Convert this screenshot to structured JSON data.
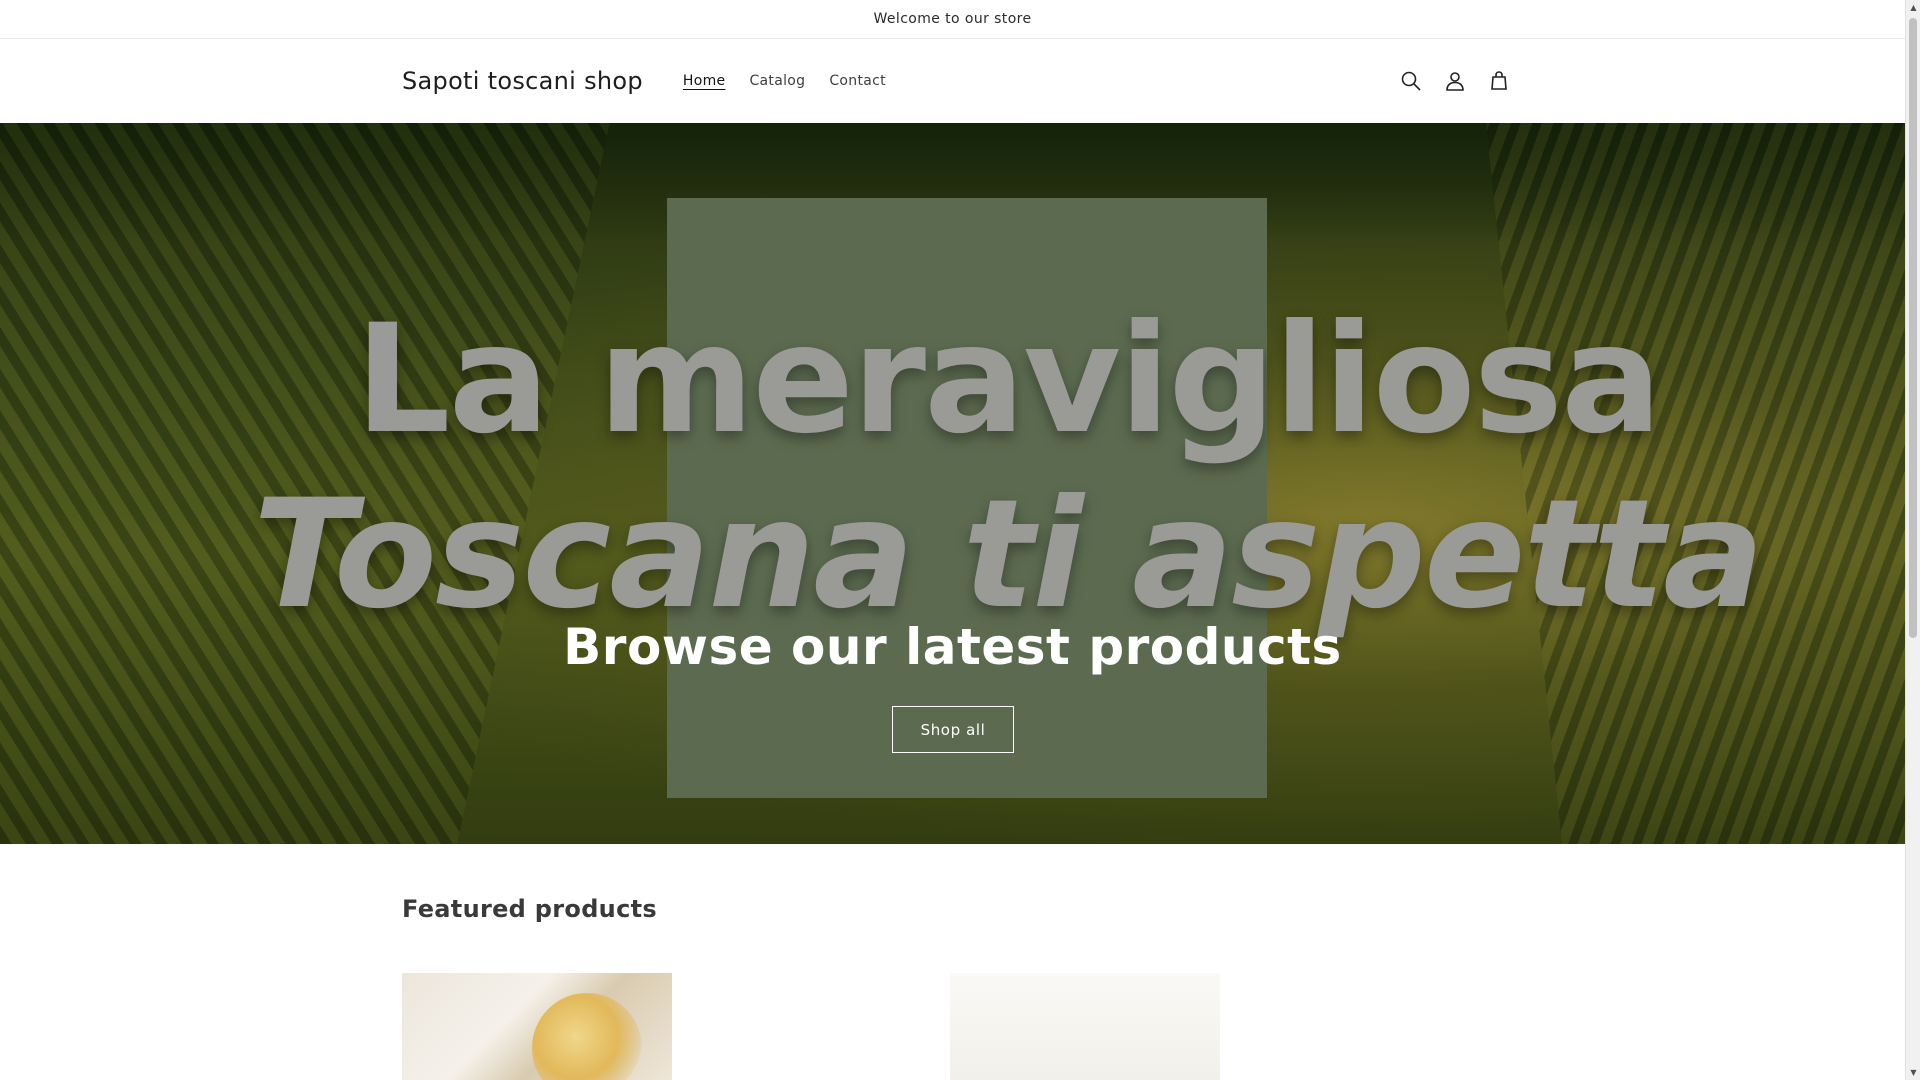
{
  "announcement": {
    "text": "Welcome to our store"
  },
  "header": {
    "logo": "Sapoti toscani shop",
    "nav": [
      {
        "label": "Home",
        "active": true
      },
      {
        "label": "Catalog",
        "active": false
      },
      {
        "label": "Contact",
        "active": false
      }
    ],
    "icons": [
      "search-icon",
      "account-icon",
      "cart-icon"
    ]
  },
  "hero": {
    "image_text_line1": "La meravigliosa",
    "image_text_line2": "Toscana ti aspetta",
    "heading": "Browse our latest products",
    "button_label": "Shop all",
    "panel_color": "#5c6b50"
  },
  "featured": {
    "title": "Featured products"
  },
  "scrollbar": {
    "up": "▲",
    "down": "▼"
  }
}
